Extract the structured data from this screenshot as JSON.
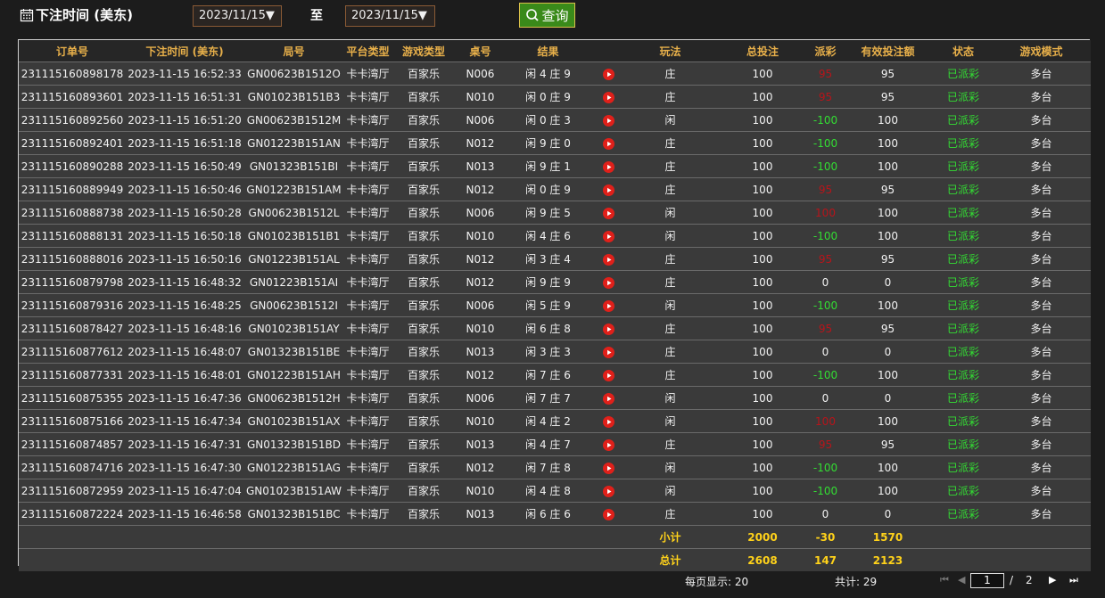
{
  "header": {
    "title": "下注时间 (美东)",
    "date_from": "2023/11/15▼",
    "to_label": "至",
    "date_to": "2023/11/15▼",
    "query_label": "查询"
  },
  "columns": [
    "订单号",
    "下注时间 (美东)",
    "局号",
    "平台类型",
    "游戏类型",
    "桌号",
    "结果",
    "",
    "玩法",
    "总投注",
    "派彩",
    "有效投注额",
    "状态",
    "游戏模式"
  ],
  "rows": [
    {
      "order": "231115160898178",
      "time": "2023-11-15 16:52:33",
      "round": "GN00623B1512O",
      "platform": "卡卡湾厅",
      "game": "百家乐",
      "table": "N006",
      "result": "闲 4 庄 9",
      "play": "庄",
      "bet": "100",
      "payout": "95",
      "payout_color": "red",
      "valid": "95",
      "status": "已派彩",
      "mode": "多台"
    },
    {
      "order": "231115160893601",
      "time": "2023-11-15 16:51:31",
      "round": "GN01023B151B3",
      "platform": "卡卡湾厅",
      "game": "百家乐",
      "table": "N010",
      "result": "闲 0 庄 9",
      "play": "庄",
      "bet": "100",
      "payout": "95",
      "payout_color": "red",
      "valid": "95",
      "status": "已派彩",
      "mode": "多台"
    },
    {
      "order": "231115160892560",
      "time": "2023-11-15 16:51:20",
      "round": "GN00623B1512M",
      "platform": "卡卡湾厅",
      "game": "百家乐",
      "table": "N006",
      "result": "闲 0 庄 3",
      "play": "闲",
      "bet": "100",
      "payout": "-100",
      "payout_color": "green",
      "valid": "100",
      "status": "已派彩",
      "mode": "多台"
    },
    {
      "order": "231115160892401",
      "time": "2023-11-15 16:51:18",
      "round": "GN01223B151AN",
      "platform": "卡卡湾厅",
      "game": "百家乐",
      "table": "N012",
      "result": "闲 9 庄 0",
      "play": "庄",
      "bet": "100",
      "payout": "-100",
      "payout_color": "green",
      "valid": "100",
      "status": "已派彩",
      "mode": "多台"
    },
    {
      "order": "231115160890288",
      "time": "2023-11-15 16:50:49",
      "round": "GN01323B151BI",
      "platform": "卡卡湾厅",
      "game": "百家乐",
      "table": "N013",
      "result": "闲 9 庄 1",
      "play": "庄",
      "bet": "100",
      "payout": "-100",
      "payout_color": "green",
      "valid": "100",
      "status": "已派彩",
      "mode": "多台"
    },
    {
      "order": "231115160889949",
      "time": "2023-11-15 16:50:46",
      "round": "GN01223B151AM",
      "platform": "卡卡湾厅",
      "game": "百家乐",
      "table": "N012",
      "result": "闲 0 庄 9",
      "play": "庄",
      "bet": "100",
      "payout": "95",
      "payout_color": "red",
      "valid": "95",
      "status": "已派彩",
      "mode": "多台"
    },
    {
      "order": "231115160888738",
      "time": "2023-11-15 16:50:28",
      "round": "GN00623B1512L",
      "platform": "卡卡湾厅",
      "game": "百家乐",
      "table": "N006",
      "result": "闲 9 庄 5",
      "play": "闲",
      "bet": "100",
      "payout": "100",
      "payout_color": "red",
      "valid": "100",
      "status": "已派彩",
      "mode": "多台"
    },
    {
      "order": "231115160888131",
      "time": "2023-11-15 16:50:18",
      "round": "GN01023B151B1",
      "platform": "卡卡湾厅",
      "game": "百家乐",
      "table": "N010",
      "result": "闲 4 庄 6",
      "play": "闲",
      "bet": "100",
      "payout": "-100",
      "payout_color": "green",
      "valid": "100",
      "status": "已派彩",
      "mode": "多台"
    },
    {
      "order": "231115160888016",
      "time": "2023-11-15 16:50:16",
      "round": "GN01223B151AL",
      "platform": "卡卡湾厅",
      "game": "百家乐",
      "table": "N012",
      "result": "闲 3 庄 4",
      "play": "庄",
      "bet": "100",
      "payout": "95",
      "payout_color": "red",
      "valid": "95",
      "status": "已派彩",
      "mode": "多台"
    },
    {
      "order": "231115160879798",
      "time": "2023-11-15 16:48:32",
      "round": "GN01223B151AI",
      "platform": "卡卡湾厅",
      "game": "百家乐",
      "table": "N012",
      "result": "闲 9 庄 9",
      "play": "庄",
      "bet": "100",
      "payout": "0",
      "payout_color": "white",
      "valid": "0",
      "status": "已派彩",
      "mode": "多台"
    },
    {
      "order": "231115160879316",
      "time": "2023-11-15 16:48:25",
      "round": "GN00623B1512I",
      "platform": "卡卡湾厅",
      "game": "百家乐",
      "table": "N006",
      "result": "闲 5 庄 9",
      "play": "闲",
      "bet": "100",
      "payout": "-100",
      "payout_color": "green",
      "valid": "100",
      "status": "已派彩",
      "mode": "多台"
    },
    {
      "order": "231115160878427",
      "time": "2023-11-15 16:48:16",
      "round": "GN01023B151AY",
      "platform": "卡卡湾厅",
      "game": "百家乐",
      "table": "N010",
      "result": "闲 6 庄 8",
      "play": "庄",
      "bet": "100",
      "payout": "95",
      "payout_color": "red",
      "valid": "95",
      "status": "已派彩",
      "mode": "多台"
    },
    {
      "order": "231115160877612",
      "time": "2023-11-15 16:48:07",
      "round": "GN01323B151BE",
      "platform": "卡卡湾厅",
      "game": "百家乐",
      "table": "N013",
      "result": "闲 3 庄 3",
      "play": "庄",
      "bet": "100",
      "payout": "0",
      "payout_color": "white",
      "valid": "0",
      "status": "已派彩",
      "mode": "多台"
    },
    {
      "order": "231115160877331",
      "time": "2023-11-15 16:48:01",
      "round": "GN01223B151AH",
      "platform": "卡卡湾厅",
      "game": "百家乐",
      "table": "N012",
      "result": "闲 7 庄 6",
      "play": "庄",
      "bet": "100",
      "payout": "-100",
      "payout_color": "green",
      "valid": "100",
      "status": "已派彩",
      "mode": "多台"
    },
    {
      "order": "231115160875355",
      "time": "2023-11-15 16:47:36",
      "round": "GN00623B1512H",
      "platform": "卡卡湾厅",
      "game": "百家乐",
      "table": "N006",
      "result": "闲 7 庄 7",
      "play": "闲",
      "bet": "100",
      "payout": "0",
      "payout_color": "white",
      "valid": "0",
      "status": "已派彩",
      "mode": "多台"
    },
    {
      "order": "231115160875166",
      "time": "2023-11-15 16:47:34",
      "round": "GN01023B151AX",
      "platform": "卡卡湾厅",
      "game": "百家乐",
      "table": "N010",
      "result": "闲 4 庄 2",
      "play": "闲",
      "bet": "100",
      "payout": "100",
      "payout_color": "red",
      "valid": "100",
      "status": "已派彩",
      "mode": "多台"
    },
    {
      "order": "231115160874857",
      "time": "2023-11-15 16:47:31",
      "round": "GN01323B151BD",
      "platform": "卡卡湾厅",
      "game": "百家乐",
      "table": "N013",
      "result": "闲 4 庄 7",
      "play": "庄",
      "bet": "100",
      "payout": "95",
      "payout_color": "red",
      "valid": "95",
      "status": "已派彩",
      "mode": "多台"
    },
    {
      "order": "231115160874716",
      "time": "2023-11-15 16:47:30",
      "round": "GN01223B151AG",
      "platform": "卡卡湾厅",
      "game": "百家乐",
      "table": "N012",
      "result": "闲 7 庄 8",
      "play": "闲",
      "bet": "100",
      "payout": "-100",
      "payout_color": "green",
      "valid": "100",
      "status": "已派彩",
      "mode": "多台"
    },
    {
      "order": "231115160872959",
      "time": "2023-11-15 16:47:04",
      "round": "GN01023B151AW",
      "platform": "卡卡湾厅",
      "game": "百家乐",
      "table": "N010",
      "result": "闲 4 庄 8",
      "play": "闲",
      "bet": "100",
      "payout": "-100",
      "payout_color": "green",
      "valid": "100",
      "status": "已派彩",
      "mode": "多台"
    },
    {
      "order": "231115160872224",
      "time": "2023-11-15 16:46:58",
      "round": "GN01323B151BC",
      "platform": "卡卡湾厅",
      "game": "百家乐",
      "table": "N013",
      "result": "闲 6 庄 6",
      "play": "庄",
      "bet": "100",
      "payout": "0",
      "payout_color": "white",
      "valid": "0",
      "status": "已派彩",
      "mode": "多台"
    }
  ],
  "subtotal": {
    "label": "小计",
    "bet": "2000",
    "payout": "-30",
    "valid": "1570"
  },
  "total": {
    "label": "总计",
    "bet": "2608",
    "payout": "147",
    "valid": "2123"
  },
  "pager": {
    "per_page_label": "每页显示: 20",
    "total_label": "共计: 29",
    "current_page": "1",
    "separator": "/",
    "total_pages": "2"
  },
  "colors": {
    "red": "#b8141a",
    "green": "#33dd33",
    "status_green": "#33dd33",
    "header_gold": "#e8b04a",
    "sum_yellow": "#ffd21a"
  },
  "icons": {
    "calendar": "calendar-icon",
    "query": "search-icon",
    "replay": "play-icon",
    "first": "first-page-icon",
    "prev": "prev-page-icon",
    "next": "next-page-icon",
    "last": "last-page-icon"
  }
}
